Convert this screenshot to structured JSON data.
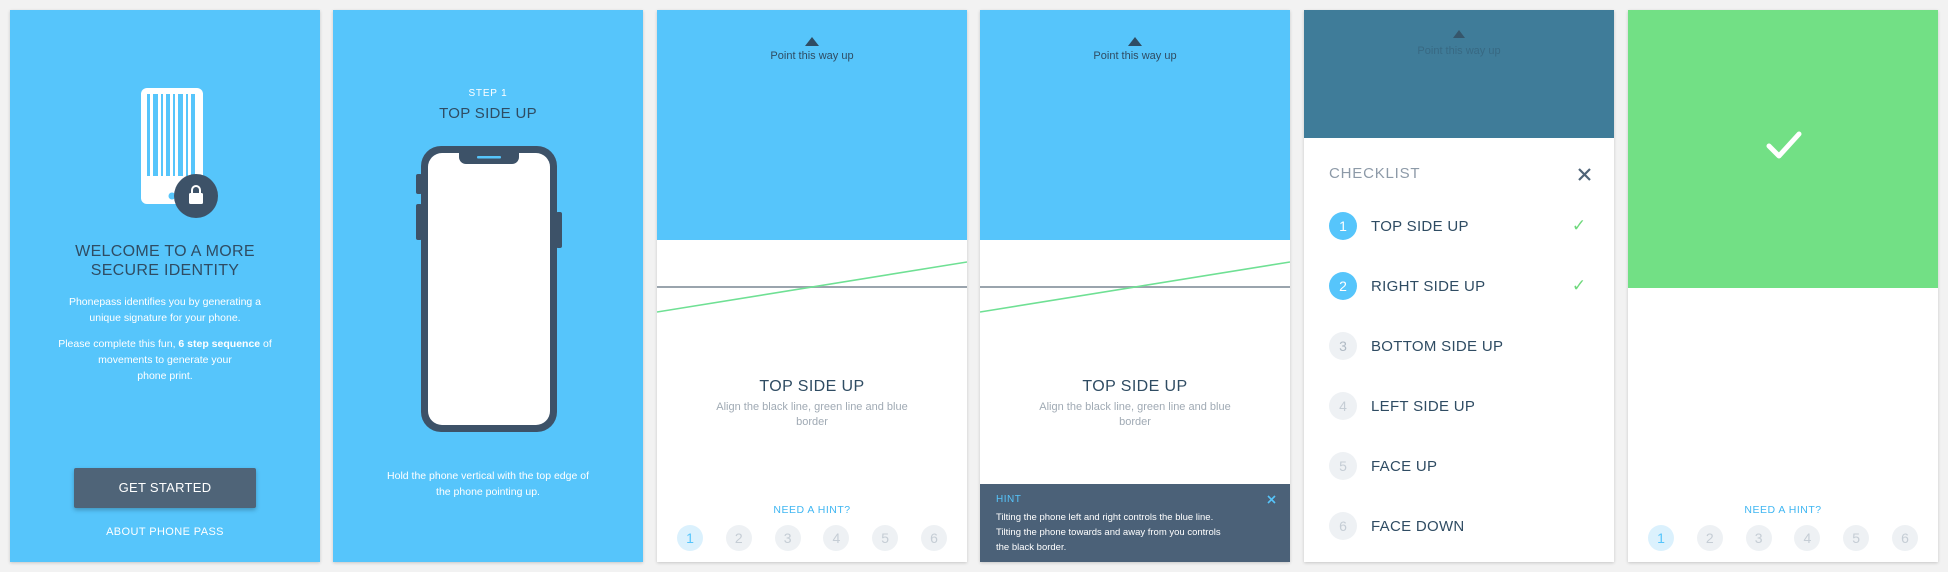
{
  "screen1": {
    "title_line1": "WELCOME TO A MORE",
    "title_line2": "SECURE IDENTITY",
    "para1_line1": "Phonepass identifies you by generating a",
    "para1_line2": "unique signature for your phone.",
    "para2_part1": "Please complete this fun, ",
    "para2_bold": "6 step sequence",
    "para2_part2": " of",
    "para2_line2": "movements to generate your",
    "para2_line3": "phone print.",
    "cta": "GET STARTED",
    "about_link": "ABOUT PHONE PASS",
    "icon": "barcode-phone-lock-icon"
  },
  "screen2": {
    "step_label": "STEP 1",
    "title": "TOP SIDE UP",
    "instruction_line1": "Hold the phone vertical with the top edge of",
    "instruction_line2": "the phone pointing up.",
    "icon": "phone-outline-icon"
  },
  "screen3": {
    "pointer": "Point this way up",
    "title": "TOP SIDE UP",
    "subtitle_line1": "Align the black line, green line and blue",
    "subtitle_line2": "border",
    "hint_link": "NEED A HINT?",
    "steps": [
      "1",
      "2",
      "3",
      "4",
      "5",
      "6"
    ]
  },
  "screen4": {
    "pointer": "Point this way up",
    "title": "TOP SIDE UP",
    "subtitle_line1": "Align the black line, green line and blue",
    "subtitle_line2": "border",
    "hint_label": "HINT",
    "hint_line1": "Tilting the phone left and right controls the blue line.",
    "hint_line2": "Tilting the phone towards and away from you controls",
    "hint_line3": "the black border."
  },
  "screen5": {
    "pointer": "Point this way up",
    "title": "CHECKLIST",
    "items": [
      {
        "num": "1",
        "label": "TOP SIDE UP"
      },
      {
        "num": "2",
        "label": "RIGHT SIDE UP"
      },
      {
        "num": "3",
        "label": "BOTTOM SIDE UP"
      },
      {
        "num": "4",
        "label": "LEFT SIDE UP"
      },
      {
        "num": "5",
        "label": "FACE UP"
      },
      {
        "num": "6",
        "label": "FACE DOWN"
      }
    ]
  },
  "screen6": {
    "hint_link": "NEED A HINT?",
    "steps": [
      "1",
      "2",
      "3",
      "4",
      "5",
      "6"
    ]
  },
  "colors": {
    "sky_blue": "#56c5fb",
    "navy": "#2f4c63",
    "slate": "#4f6478",
    "success_green": "#72e085",
    "overlay_teal": "#3f7c99"
  }
}
